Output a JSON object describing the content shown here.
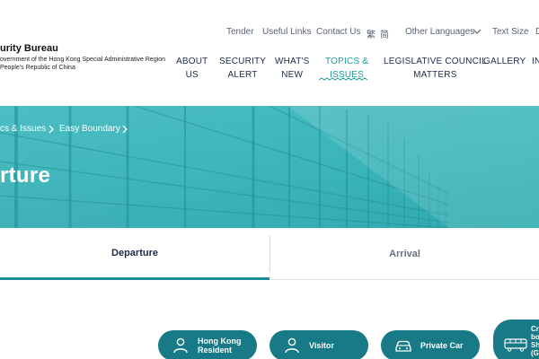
{
  "header": {
    "bureau_title": "urity Bureau",
    "bureau_sub_line1": "overnment of the Hong Kong Special Administrative Region",
    "bureau_sub_line2": "People's Republic of China",
    "utility": {
      "tender": "Tender",
      "useful_links": "Useful Links",
      "contact_us": "Contact Us",
      "lang_trad": "繁",
      "lang_simp": "简",
      "other_languages": "Other Languages",
      "text_size": "Text Size",
      "cut_off": "D"
    },
    "nav": [
      {
        "line1": "ABOUT",
        "line2": "US"
      },
      {
        "line1": "SECURITY",
        "line2": "ALERT"
      },
      {
        "line1": "WHAT'S",
        "line2": "NEW"
      },
      {
        "line1": "TOPICS &",
        "line2": "ISSUES"
      },
      {
        "line1": "LEGISLATIVE COUNCIL",
        "line2": "MATTERS"
      },
      {
        "line1": "GALLERY",
        "line2": ""
      },
      {
        "line1": "",
        "line2": "IN"
      }
    ]
  },
  "breadcrumb": {
    "item1": "cs & Issues",
    "item2": "Easy Boundary"
  },
  "banner": {
    "title": "rture"
  },
  "tabs": {
    "departure": "Departure",
    "arrival": "Arrival"
  },
  "travel_types": [
    {
      "line1": "Hong Kong",
      "line2": "Resident",
      "icon": "person-icon"
    },
    {
      "line1": "Visitor",
      "line2": "",
      "icon": "person-icon"
    },
    {
      "line1": "Private Car",
      "line2": "",
      "icon": "car-icon"
    },
    {
      "line1": "Cr",
      "line2": "bo",
      "line3": "Sh",
      "line4": "(G",
      "icon": "bus-icon"
    }
  ],
  "colors": {
    "accent": "#1a9d9a",
    "button": "#177a86",
    "banner": "#33b3b8",
    "nav_text": "#1d2b4a"
  }
}
